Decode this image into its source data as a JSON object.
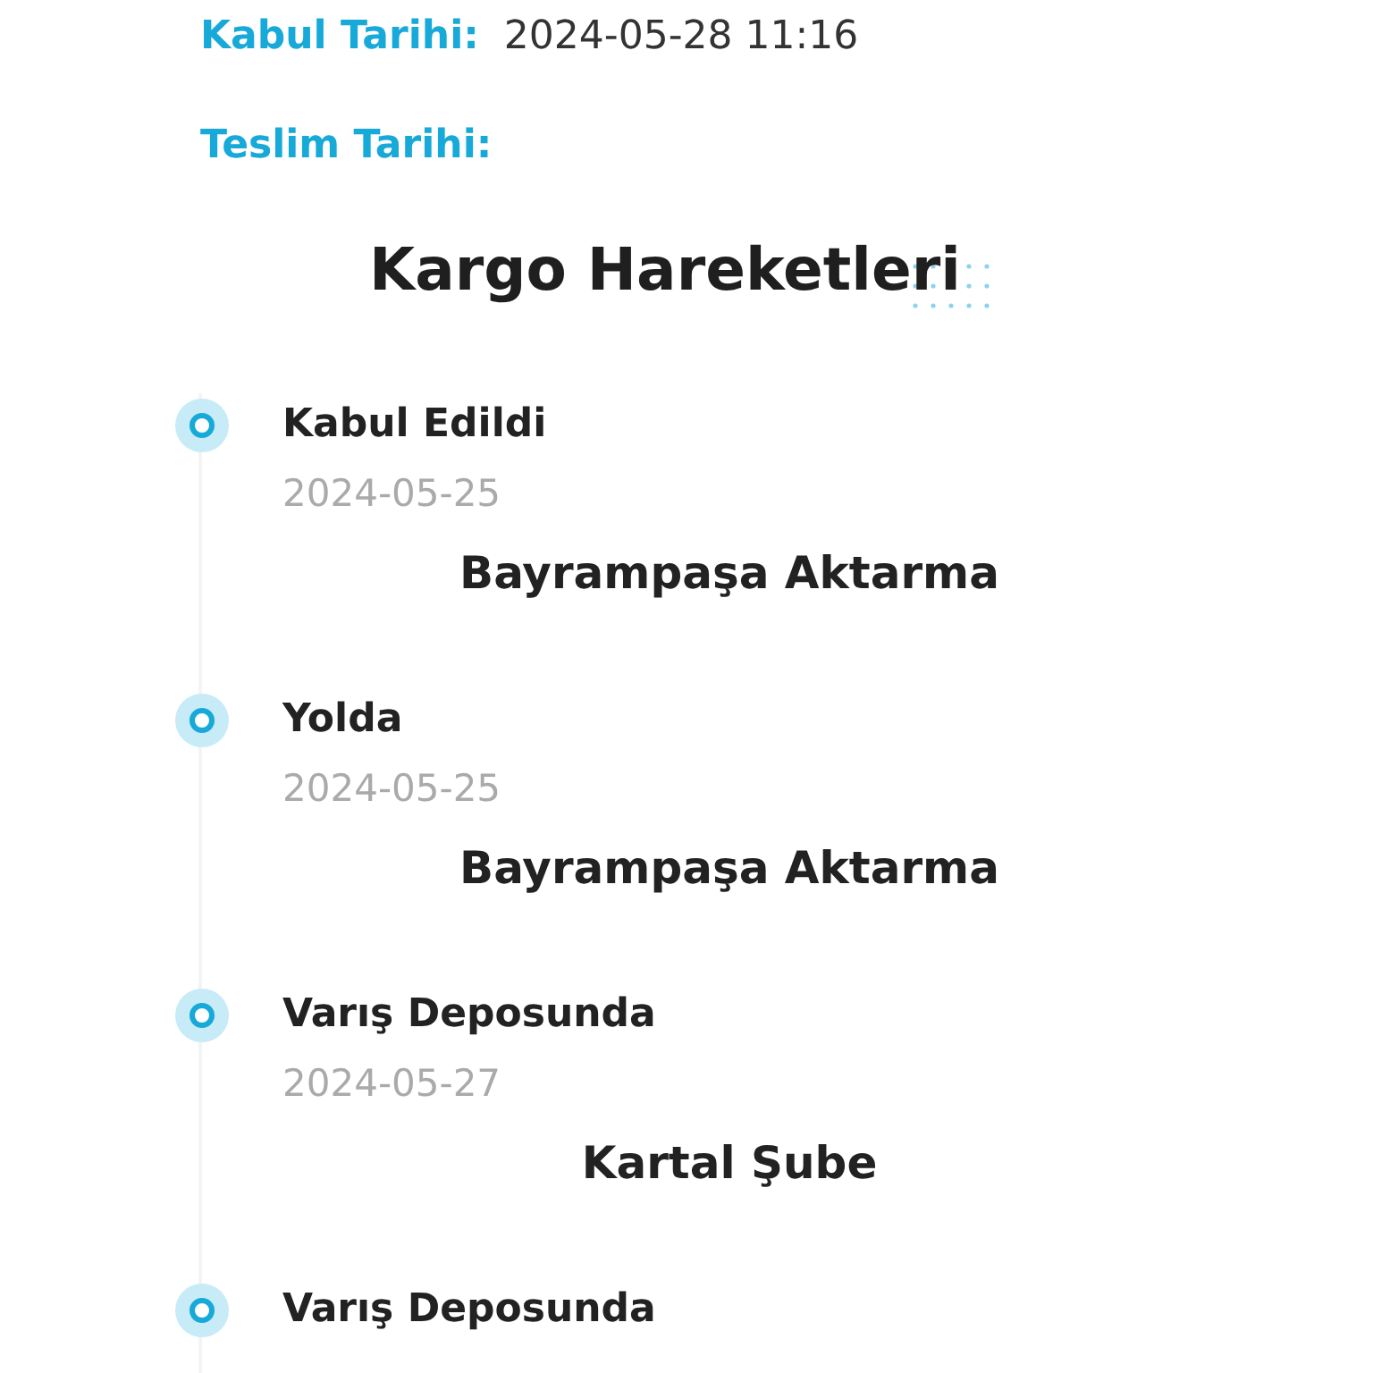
{
  "acceptance": {
    "label": "Kabul Tarihi:",
    "value": "2024-05-28 11:16"
  },
  "delivery": {
    "label": "Teslim Tarihi:"
  },
  "title": "Kargo Hareketleri",
  "events": [
    {
      "status": "Kabul Edildi",
      "date": "2024-05-25",
      "location": "Bayrampaşa Aktarma"
    },
    {
      "status": "Yolda",
      "date": "2024-05-25",
      "location": "Bayrampaşa Aktarma"
    },
    {
      "status": "Varış Deposunda",
      "date": "2024-05-27",
      "location": "Kartal Şube"
    },
    {
      "status": "Varış Deposunda"
    }
  ]
}
